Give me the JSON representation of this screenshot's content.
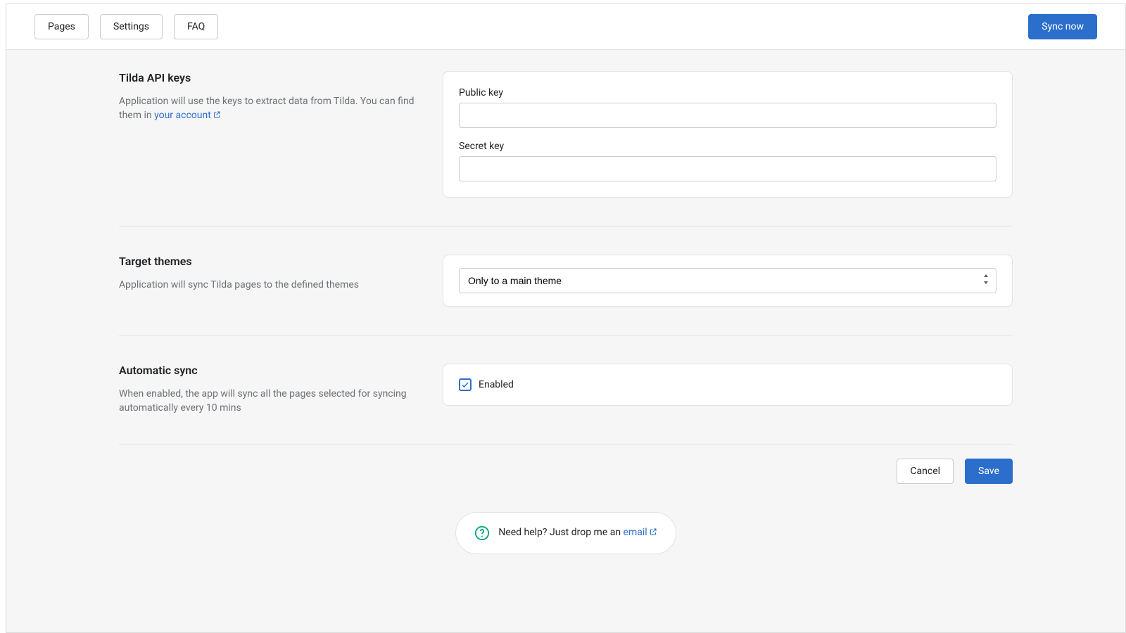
{
  "topbar": {
    "tabs": {
      "pages": "Pages",
      "settings": "Settings",
      "faq": "FAQ"
    },
    "sync_now": "Sync now"
  },
  "sections": {
    "api": {
      "title": "Tilda API keys",
      "desc_prefix": "Application will use the keys to extract data from Tilda. You can find them in ",
      "account_link": "your account",
      "public_key_label": "Public key",
      "public_key_value": "",
      "secret_key_label": "Secret key",
      "secret_key_value": ""
    },
    "themes": {
      "title": "Target themes",
      "desc": "Application will sync Tilda pages to the defined themes",
      "selected": "Only to a main theme"
    },
    "autosync": {
      "title": "Automatic sync",
      "desc": "When enabled, the app will sync all the pages selected for syncing automatically every 10 mins",
      "enabled_label": "Enabled",
      "checked": true
    }
  },
  "actions": {
    "cancel": "Cancel",
    "save": "Save"
  },
  "help": {
    "text_prefix": "Need help? Just drop me an ",
    "email_label": "email"
  }
}
